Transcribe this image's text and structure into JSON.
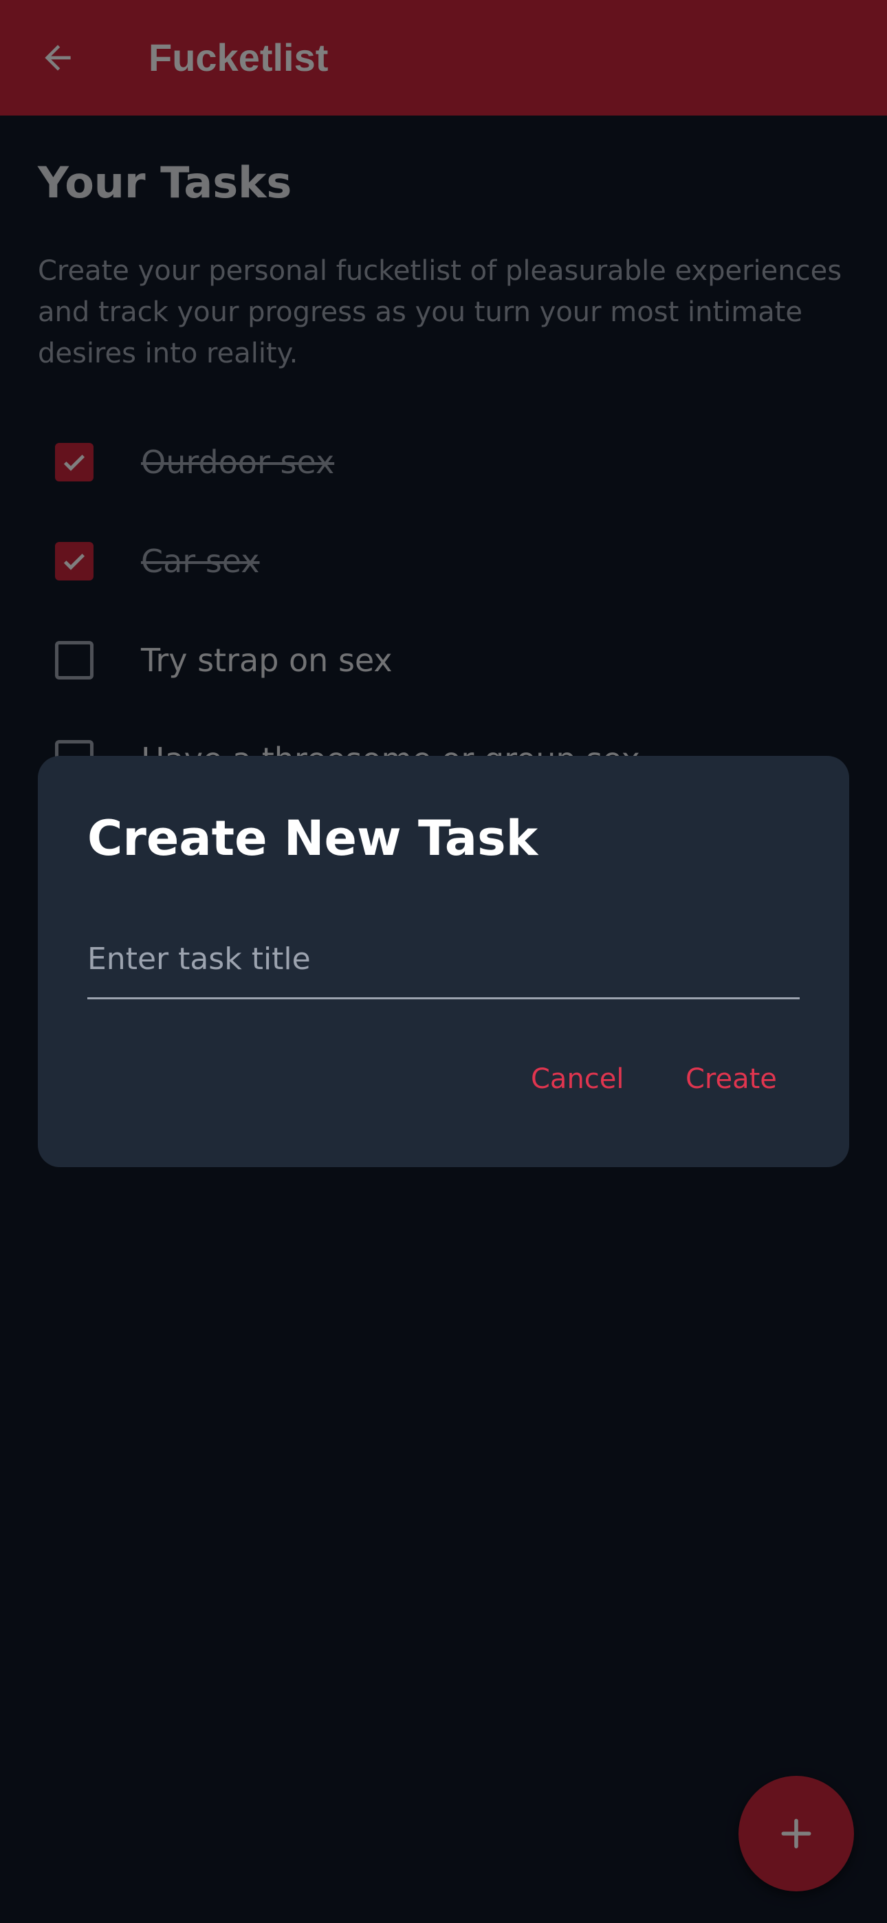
{
  "app_bar": {
    "title": "Fucketlist",
    "back_icon": "arrow-left-icon",
    "color": "#c8243a"
  },
  "page": {
    "heading": "Your Tasks",
    "description": "Create your personal fucketlist of pleasurable experiences and track your progress as you turn your most intimate desires into reality."
  },
  "tasks": [
    {
      "label": "Ourdoor sex",
      "completed": true
    },
    {
      "label": "Car sex",
      "completed": true
    },
    {
      "label": "Try strap on sex",
      "completed": false
    },
    {
      "label": "Have a threesome or group sex",
      "completed": false
    }
  ],
  "fab": {
    "icon": "plus-icon"
  },
  "dialog": {
    "title": "Create New Task",
    "input_placeholder": "Enter task title",
    "input_value": "",
    "cancel_label": "Cancel",
    "create_label": "Create",
    "accent_color": "#e0354f"
  }
}
